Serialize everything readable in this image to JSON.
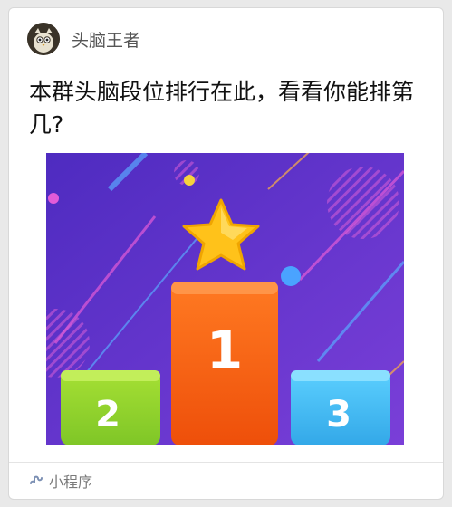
{
  "header": {
    "app_name": "头脑王者",
    "avatar_icon": "cartoon-owl-avatar"
  },
  "message": {
    "title": "本群头脑段位排行在此，看看你能排第几?"
  },
  "preview": {
    "podium": {
      "first": "1",
      "second": "2",
      "third": "3"
    },
    "icon": "star-icon"
  },
  "footer": {
    "label": "小程序",
    "icon": "mini-program-icon"
  },
  "colors": {
    "background": "#6138c9",
    "podium_first": "#f35b12",
    "podium_second": "#8fd12f",
    "podium_third": "#3fb7ef",
    "star": "#ffc21a"
  }
}
